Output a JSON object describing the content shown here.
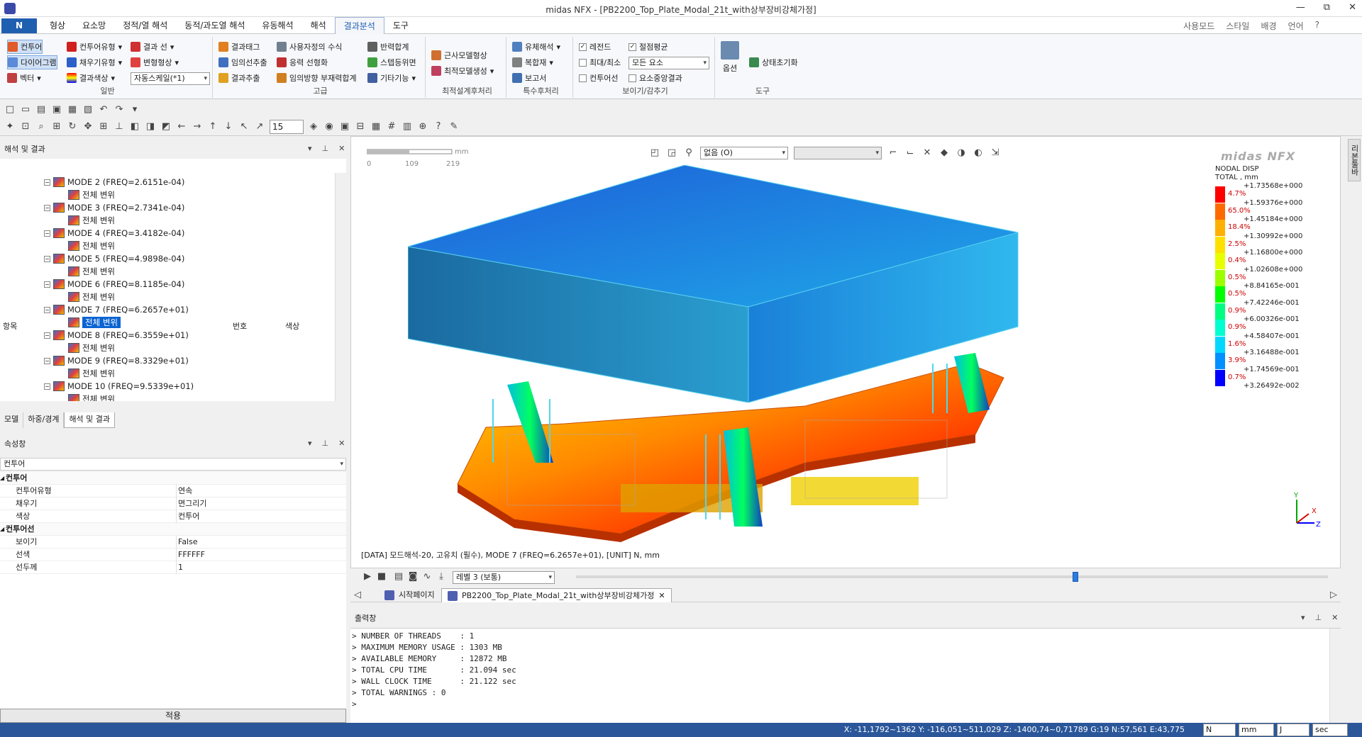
{
  "window": {
    "title": "midas NFX - [PB2200_Top_Plate_Modal_21t_with상부장비강체가정]",
    "controls": [
      "—",
      "⧉",
      "✕"
    ]
  },
  "menu": {
    "app_button": "N",
    "tabs": [
      "형상",
      "요소망",
      "정적/열 해석",
      "동적/과도열 해석",
      "유동해석",
      "해석",
      "결과분석",
      "도구"
    ],
    "active_tab": "결과분석",
    "right": [
      "사용모드",
      "스타일",
      "배경",
      "언어",
      "?"
    ]
  },
  "ribbon": {
    "general": {
      "label": "일반",
      "contour": "컨투어",
      "diagram": "다이어그램",
      "vector": "벡터",
      "contour_type": "컨투어유형",
      "fill_type": "채우기유형",
      "result_color": "결과색상",
      "result_line": "결과 선",
      "deform_shape": "변형형상",
      "auto_scale": "자동스케일(*1)"
    },
    "advanced": {
      "label": "고급",
      "result_tag": "결과태그",
      "arbitrary_extract": "임의선추출",
      "result_extract": "결과추출",
      "user_formula": "사용자정의 수식",
      "stress_linearize": "응력 선형화",
      "arbitrary_member": "임의방향 부재력합계",
      "reaction_sum": "반력합계",
      "step_history": "스텝등위면",
      "others": "기타기능"
    },
    "optimal": {
      "label": "최적설계후처리",
      "approx_shape": "근사모델형상",
      "optimal_gen": "최적모델생성"
    },
    "special": {
      "label": "특수후처리",
      "fluid": "유체해석",
      "composite": "복합재",
      "report": "보고서"
    },
    "show": {
      "label": "보이기/감추기",
      "legend": "레전드",
      "nodal_avg": "절점평균",
      "max_min": "최대/최소",
      "element_select": "모든 요소",
      "contour_line": "컨투어선",
      "element_center": "요소중앙결과"
    },
    "tools": {
      "label": "도구",
      "options": "옵션",
      "status_reset": "상태초기화"
    }
  },
  "toolbar": {
    "zoom_value": "15"
  },
  "analysis_panel": {
    "title": "해석 및 결과",
    "col_item": "항목",
    "col_num": "번호",
    "col_color": "색상",
    "nodes": [
      {
        "label": "MODE 2 (FREQ=2.6151e-04)",
        "child": "전체 변위"
      },
      {
        "label": "MODE 3 (FREQ=2.7341e-04)",
        "child": "전체 변위"
      },
      {
        "label": "MODE 4 (FREQ=3.4182e-04)",
        "child": "전체 변위"
      },
      {
        "label": "MODE 5 (FREQ=4.9898e-04)",
        "child": "전체 변위"
      },
      {
        "label": "MODE 6 (FREQ=8.1185e-04)",
        "child": "전체 변위"
      },
      {
        "label": "MODE 7 (FREQ=6.2657e+01)",
        "child": "전체 변위"
      },
      {
        "label": "MODE 8 (FREQ=6.3559e+01)",
        "child": "전체 변위"
      },
      {
        "label": "MODE 9 (FREQ=8.3329e+01)",
        "child": "전체 변위"
      },
      {
        "label": "MODE 10 (FREQ=9.5339e+01)",
        "child": "전체 변위"
      }
    ],
    "selected_node": 5,
    "bottom_tabs": [
      "모델",
      "하중/경계",
      "해석 및 결과"
    ]
  },
  "props_panel": {
    "title": "속성창",
    "dropdown": "컨투어",
    "rows": [
      {
        "cat": true,
        "k": "컨투어",
        "v": ""
      },
      {
        "k": "컨투어유형",
        "v": "연속"
      },
      {
        "k": "채우기",
        "v": "면그리기"
      },
      {
        "k": "색상",
        "v": "컨투어"
      },
      {
        "cat": true,
        "k": "컨투어선",
        "v": ""
      },
      {
        "k": "보이기",
        "v": "False"
      },
      {
        "k": "선색",
        "v": "FFFFFF"
      },
      {
        "k": "선두께",
        "v": "1"
      }
    ],
    "apply": "적용"
  },
  "viewport": {
    "ruler_labels": [
      "0",
      "109",
      "219"
    ],
    "ruler_unit": "mm",
    "display_combo": "없음 (O)",
    "legend": {
      "logo": "midas NFX",
      "title1": "NODAL DISP",
      "title2": "TOTAL , mm",
      "values": [
        "+1.73568e+000",
        "+1.59376e+000",
        "+1.45184e+000",
        "+1.30992e+000",
        "+1.16800e+000",
        "+1.02608e+000",
        "+8.84165e-001",
        "+7.42246e-001",
        "+6.00326e-001",
        "+4.58407e-001",
        "+3.16488e-001",
        "+1.74569e-001",
        "+3.26492e-002"
      ],
      "pcts": [
        "4.7%",
        "65.0%",
        "18.4%",
        "2.5%",
        "0.4%",
        "0.5%",
        "0.5%",
        "0.9%",
        "0.9%",
        "1.6%",
        "3.9%",
        "0.7%"
      ],
      "colors": [
        "#ff0000",
        "#ff6a00",
        "#ffb000",
        "#ffe000",
        "#e8ff00",
        "#9cff00",
        "#00ff00",
        "#00ff80",
        "#00ffd0",
        "#00d8ff",
        "#0090ff",
        "#0000ff"
      ]
    },
    "status": "[DATA] 모드해석-20,  고유치 (필수), MODE 7 (FREQ=6.2657e+01),  [UNIT]   N,  mm"
  },
  "animbar": {
    "level": "레벨 3 (보통)",
    "frame_fraction": 0.66
  },
  "doc_tabs": [
    "시작페이지",
    "PB2200_Top_Plate_Modal_21t_with상부장비강체가정"
  ],
  "output": {
    "title": "출력창",
    "lines": [
      "> NUMBER OF THREADS    : 1",
      "> MAXIMUM MEMORY USAGE : 1303 MB",
      "> AVAILABLE MEMORY     : 12872 MB",
      "> TOTAL CPU TIME       : 21.094 sec",
      "> WALL CLOCK TIME      : 21.122 sec",
      "> TOTAL WARNINGS : 0",
      ">"
    ]
  },
  "statusbar": {
    "coords": "X: -11,1792~1362 Y: -116,051~511,029 Z: -1400,74~0,71789   G:19  N:57,561  E:43,775",
    "units": [
      "N",
      "mm",
      "J",
      "sec"
    ]
  },
  "side_tab": "리본툴바"
}
